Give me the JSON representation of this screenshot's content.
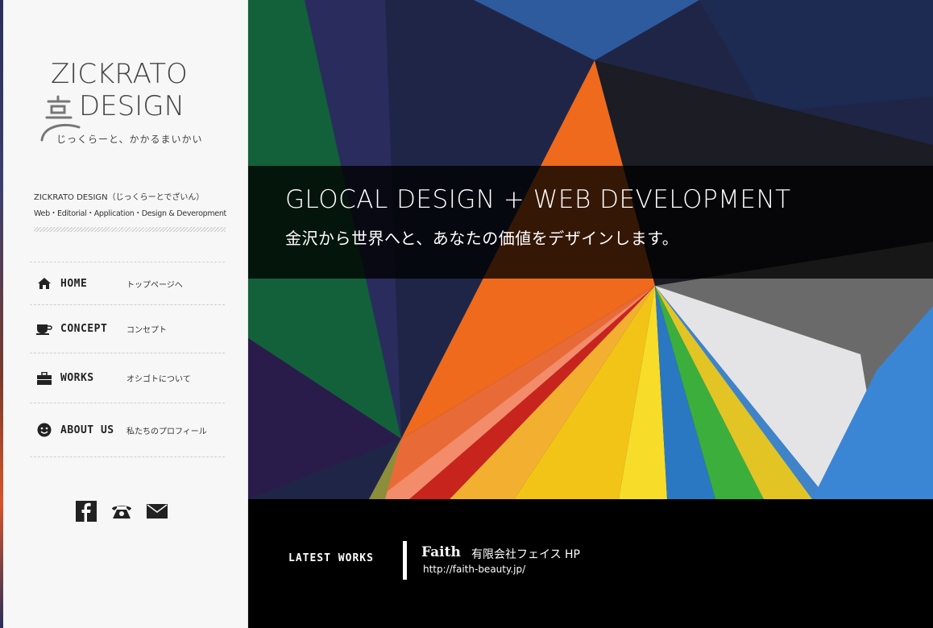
{
  "logo": {
    "line1": "ZICKRATO",
    "line2": "DESIGN",
    "tagline": "じっくらーと、かかるまいかい"
  },
  "site": {
    "name": "ZICKRATO DESIGN（じっくらーとでざいん）",
    "services": "Web・Editorial・Application・Design & Deveropment"
  },
  "nav": {
    "items": [
      {
        "en": "HOME",
        "ja": "トップページへ",
        "icon": "home-icon"
      },
      {
        "en": "CONCEPT",
        "ja": "コンセプト",
        "icon": "coffee-cup-icon"
      },
      {
        "en": "WORKS",
        "ja": "オシゴトについて",
        "icon": "briefcase-icon"
      },
      {
        "en": "ABOUT US",
        "ja": "私たちのプロフィール",
        "icon": "smiley-icon"
      }
    ]
  },
  "social": [
    {
      "icon": "facebook-icon"
    },
    {
      "icon": "phone-icon"
    },
    {
      "icon": "mail-icon"
    }
  ],
  "hero": {
    "title": "GLOCAL DESIGN + WEB DEVELOPMENT",
    "subtitle": "金沢から世界へと、あなたの価値をデザインします。"
  },
  "latest": {
    "label": "LATEST WORKS",
    "brand": "Faith",
    "title": "有限会社フェイス HP",
    "url": "http://faith-beauty.jp/"
  }
}
